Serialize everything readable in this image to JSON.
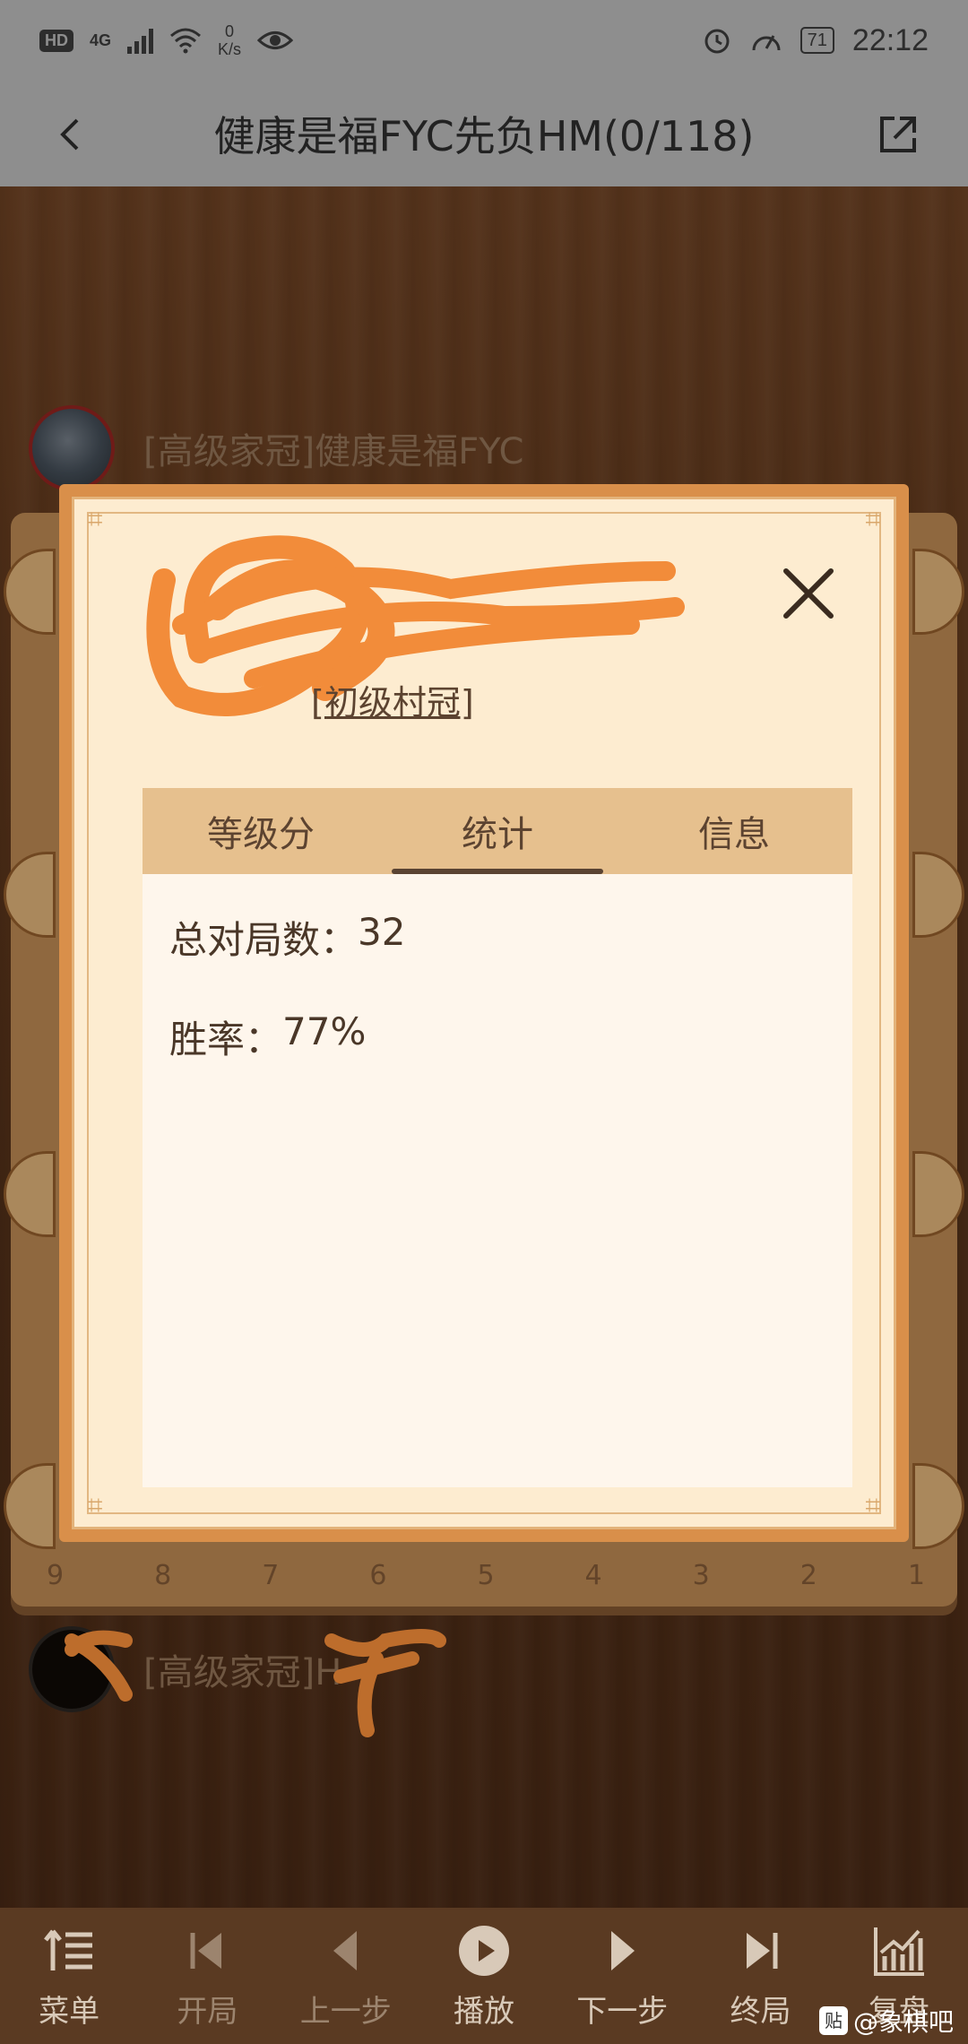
{
  "status_bar": {
    "hd": "HD",
    "net": "4G",
    "speed_value": "0",
    "speed_unit": "K/s",
    "battery": "71",
    "time": "22:12"
  },
  "header": {
    "title": "健康是福FYC先负HM(0/118)"
  },
  "players": {
    "top_name": "[高级家冠]健康是福FYC",
    "bottom_name": "[高级家冠]H"
  },
  "board": {
    "file_numbers": [
      "9",
      "8",
      "7",
      "6",
      "5",
      "4",
      "3",
      "2",
      "1"
    ]
  },
  "modal": {
    "rank": "[初级村冠]",
    "tabs": [
      {
        "label": "等级分"
      },
      {
        "label": "统计"
      },
      {
        "label": "信息"
      }
    ],
    "active_tab": 1,
    "stats": {
      "total_games_label": "总对局数：",
      "total_games_value": "32",
      "win_rate_label": "胜率：",
      "win_rate_value": "77%"
    }
  },
  "toolbar": {
    "items": [
      {
        "label": "菜单",
        "icon": "menu-icon"
      },
      {
        "label": "开局",
        "icon": "first-move-icon"
      },
      {
        "label": "上一步",
        "icon": "previous-move-icon"
      },
      {
        "label": "播放",
        "icon": "play-icon"
      },
      {
        "label": "下一步",
        "icon": "next-move-icon"
      },
      {
        "label": "终局",
        "icon": "last-move-icon"
      },
      {
        "label": "复盘",
        "icon": "analysis-chart-icon"
      }
    ]
  },
  "watermark": "@象棋吧",
  "colors": {
    "modal_frame": "#d98f4a",
    "modal_bg": "#fdecd0",
    "tab_bar": "#e6c08e",
    "scribble": "#f28c3a"
  }
}
